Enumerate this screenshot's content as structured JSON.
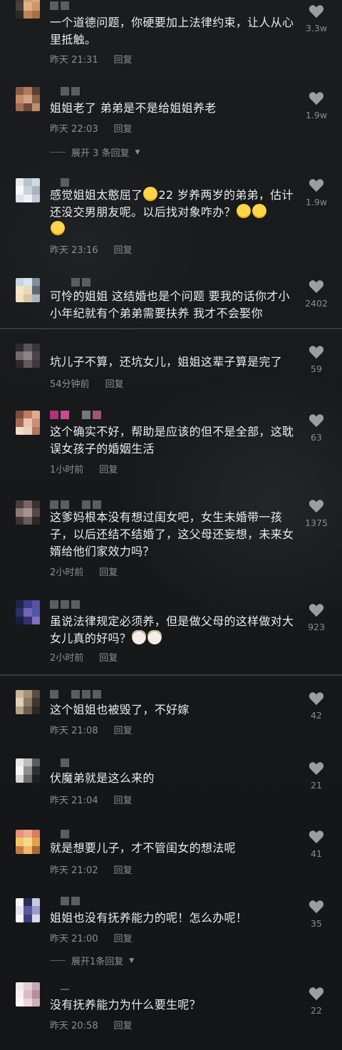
{
  "comments": [
    {
      "text": "一个道德问题，你硬要加上法律约束，让人从心里抵触。",
      "time": "昨天 21:31",
      "reply": "回复",
      "likes": "3.3w",
      "avatar": [
        "#3a3a3a",
        "#caa171",
        "#d9a77d",
        "#4a4038",
        "#e2b183",
        "#cf9664",
        "#2a2a2a",
        "#b88458",
        "#a87048"
      ]
    },
    {
      "text": "姐姐老了 弟弟是不是给姐姐养老",
      "time": "昨天 22:03",
      "reply": "回复",
      "likes": "1.9w",
      "avatar": [
        "#8a5e46",
        "#b07a5d",
        "#5b4032",
        "#c18a6a",
        "#d2a183",
        "#8f6149",
        "#a26d52",
        "#6b4a3a",
        "#c08e70"
      ]
    },
    {
      "text": "感觉姐姐太憨屈了",
      "text2": "22 岁养两岁的弟弟，估计还没交男朋友呢。以后找对象咋办？",
      "time": "昨天 23:16",
      "reply": "回复",
      "likes": "1.9w",
      "avatar": [
        "#e8ecf2",
        "#b9c3cf",
        "#d2d9e2",
        "#f5f7fa",
        "#c9d1db",
        "#a7b2bf",
        "#dde3ea",
        "#eef1f5",
        "#c2cad4"
      ]
    },
    {
      "text": "可怜的姐姐 这结婚也是个问题 要我的话你才小小年纪就有个弟弟需要扶养 我才不会娶你",
      "likes": "2402",
      "avatar": [
        "#c6d6e2",
        "#d9e4ec",
        "#7f8f9c",
        "#f2e6c9",
        "#e8d9b8",
        "#5d6a74",
        "#efe2c3",
        "#d8c7a1",
        "#a9b6c0"
      ]
    },
    {
      "text": "坑儿子不算，还坑女儿，姐姐这辈子算是完了",
      "time": "54分钟前",
      "reply": "回复",
      "likes": "59",
      "avatar": [
        "#2b2b2d",
        "#5a5458",
        "#3b3638",
        "#716a6c",
        "#8d8488",
        "#4a4446",
        "#2e2a2c",
        "#605a5d",
        "#3d3839"
      ]
    },
    {
      "text": "这个确实不好，帮助是应该的但不是全部，这耽误女孩子的婚姻生活",
      "time": "1小时前",
      "reply": "回复",
      "likes": "63",
      "avatar": [
        "#7c4d3a",
        "#b97e62",
        "#d9ad93",
        "#a46a52",
        "#e6c4ae",
        "#c99076",
        "#f1dccd",
        "#e9cfbd",
        "#b0775d"
      ]
    },
    {
      "text": "这爹妈根本没有想过闺女吧，女生未婚带一孩子，以后还结不结婚了，这父母还妄想，未来女婿给他们家效力吗？",
      "time": "2小时前",
      "reply": "回复",
      "likes": "1375",
      "avatar": [
        "#4a3d3c",
        "#7a6562",
        "#3a302f",
        "#8e7a78",
        "#a99391",
        "#55484a",
        "#3d3435",
        "#6b5b5a",
        "#2f2828"
      ]
    },
    {
      "text": "虽说法律规定必须养，但是做父母的这样做对大女儿真的好吗？",
      "time": "2小时前",
      "reply": "回复",
      "likes": "923",
      "avatar": [
        "#1d2547",
        "#3b3f86",
        "#5a4fa5",
        "#2b2f66",
        "#7364b4",
        "#4e57a8",
        "#1a1f3c",
        "#36306b",
        "#8270c2"
      ]
    },
    {
      "text": "这个姐姐也被毁了，不好嫁",
      "time": "昨天 21:08",
      "reply": "回复",
      "likes": "42",
      "avatar": [
        "#c8b59a",
        "#a89274",
        "#5a4c3f",
        "#e0d0b5",
        "#8d7a62",
        "#3f3630",
        "#b6a286",
        "#6d5d4c",
        "#2e2824"
      ]
    },
    {
      "text": "伏魔弟就是这么来的",
      "time": "昨天 21:04",
      "reply": "回复",
      "likes": "21",
      "avatar": [
        "#e8e8e8",
        "#bdbdbd",
        "#5b5b5b",
        "#f4f4f4",
        "#8f8f8f",
        "#2f2f2f",
        "#d6d6d6",
        "#6d6d6d",
        "#1f1f1f"
      ]
    },
    {
      "text": "就是想要儿子，才不管闺女的想法呢",
      "time": "昨天 21:02",
      "reply": "回复",
      "likes": "41",
      "avatar": [
        "#e8927a",
        "#f0a88e",
        "#d97c62",
        "#f2c46a",
        "#f5d98a",
        "#e0a24a",
        "#c07a4a",
        "#f3b764",
        "#a86a3a"
      ]
    },
    {
      "text": "姐姐也没有抚养能力的呢！怎么办呢！",
      "time": "昨天 21:00",
      "reply": "回复",
      "likes": "35",
      "avatar": [
        "#f3f3f8",
        "#2a2d56",
        "#c8c9e3",
        "#e4e4ef",
        "#58599a",
        "#9b9cc7",
        "#f8f8fb",
        "#3d3f78",
        "#d9d9ea"
      ]
    },
    {
      "text": "没有抚养能力为什么要生呢？",
      "time": "昨天 20:58",
      "reply": "回复",
      "likes": "22",
      "avatar": [
        "#f3e7eb",
        "#e4cdd4",
        "#c7a8b2",
        "#f8eff2",
        "#d9bcc6",
        "#b88e9b",
        "#fbf5f7",
        "#ead7dd",
        "#cfaebb"
      ]
    }
  ],
  "expand_labels": {
    "first": "展开 3 条回复",
    "second": "展开1条回复"
  }
}
